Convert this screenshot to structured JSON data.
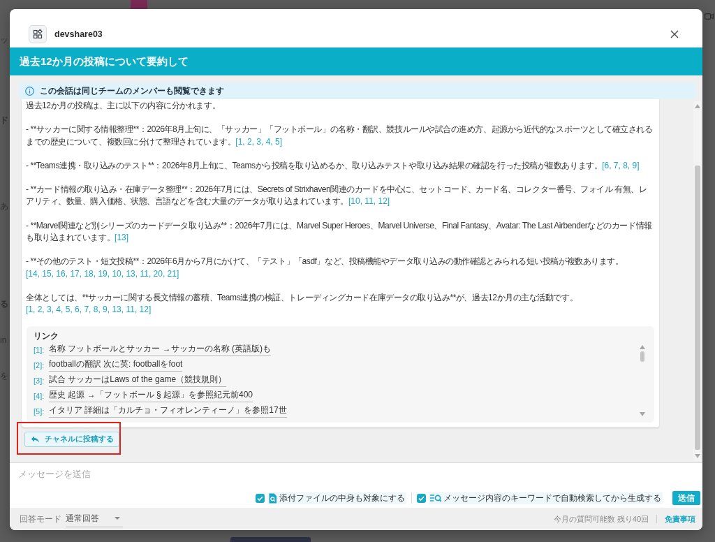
{
  "background": {
    "fragments": [
      "ッ",
      "ド",
      "あ",
      "る",
      "in",
      "を"
    ]
  },
  "dialog": {
    "app_name": "devshare03",
    "title": "過去12か月の投稿について要約して",
    "notice": "この会話は同じチームのメンバーも閲覧できます",
    "answer": {
      "paragraphs": [
        {
          "text": "過去12か月の投稿は、主に以下の内容に分かれます。"
        },
        {
          "text": "- **サッカーに関する情報整理**：2026年8月上旬に、「サッカー」「フットボール」の名称・翻訳、競技ルールや試合の進め方、起源から近代的なスポーツとして確立されるまでの歴史について、複数回に分けて整理されています。",
          "refs": "[1, 2, 3, 4, 5]"
        },
        {
          "text": "- **Teams連携・取り込みのテスト**：2026年8月上旬に、Teamsから投稿を取り込めるか、取り込みテストや取り込み結果の確認を行った投稿が複数あります。",
          "refs": "[6, 7, 8, 9]"
        },
        {
          "text": "- **カード情報の取り込み・在庫データ整理**：2026年7月には、Secrets of Strixhaven関連のカードを中心に、セットコード、カード名、コレクター番号、フォイル 有無、レアリティ、数量、購入価格、状態、言語などを含む大量のデータが取り込まれています。",
          "refs": "[10, 11, 12]"
        },
        {
          "text": "- **Marvel関連など別シリーズのカードデータ取り込み**：2026年7月には、Marvel Super Heroes、Marvel Universe、Final Fantasy、Avatar: The Last Airbenderなどのカード情報も取り込まれています。",
          "refs": "[13]"
        },
        {
          "text": "- **その他のテスト・短文投稿**：2026年6月から7月にかけて、「テスト」「asdf」など、投稿機能やデータ取り込みの動作確認とみられる短い投稿が複数あります。",
          "refs": "[14, 15, 16, 17, 18, 19, 10, 13, 11, 20, 21]"
        },
        {
          "text": "全体としては、**サッカーに関する長文情報の蓄積、Teams連携の検証、トレーディングカード在庫データの取り込み**が、過去12か月の主な活動です。",
          "refs": "[1, 2, 3, 4, 5, 6, 7, 8, 9, 13, 11, 12]"
        }
      ],
      "links": {
        "heading": "リンク",
        "items": [
          {
            "ref": "[1]:",
            "text": "名称 フットボールとサッカー →サッカーの名称 (英語版)も"
          },
          {
            "ref": "[2]:",
            "text": "footballの翻訳 次に英: footballをfoot"
          },
          {
            "ref": "[3]:",
            "text": "試合 サッカーはLaws of the game（競技規則）"
          },
          {
            "ref": "[4]:",
            "text": "歴史 起源 →「フットボール § 起源」を参照紀元前400"
          },
          {
            "ref": "[5]:",
            "text": "イタリア 詳細は「カルチョ・フィオレンティーノ」を参照17世"
          }
        ]
      }
    },
    "post_button": {
      "label": "チャネルに投稿する",
      "highlighted": true
    },
    "composer": {
      "placeholder": "メッセージを送信",
      "options": [
        {
          "kind": "file",
          "label": "添付ファイルの中身も対象にする",
          "checked": true
        },
        {
          "kind": "keyword",
          "label": "メッセージ内容のキーワードで自動検索してから生成する",
          "checked": true
        }
      ],
      "send_button": "送信"
    },
    "footer": {
      "mode_label": "回答モード",
      "mode_value": "通常回答",
      "quota": "今月の質問可能数 残り40回",
      "disclaimer": "免責事項"
    }
  }
}
